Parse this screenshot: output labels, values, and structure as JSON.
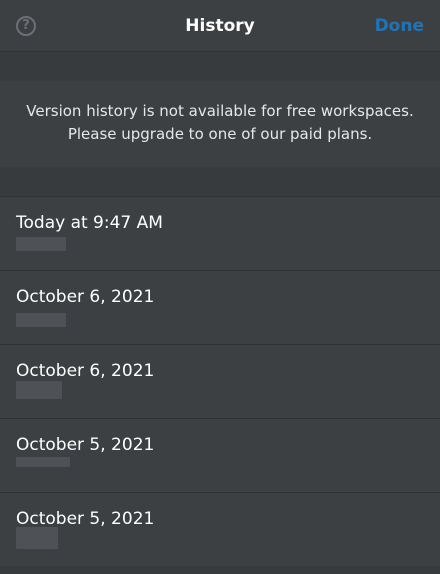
{
  "header": {
    "title": "History",
    "help_icon": "?",
    "done_label": "Done"
  },
  "notice": {
    "line1": "Version history is not available for free workspaces.",
    "line2": "Please upgrade to one of our paid plans."
  },
  "history": {
    "items": [
      {
        "label": "Today at 9:47 AM"
      },
      {
        "label": "October 6, 2021"
      },
      {
        "label": "October 6, 2021"
      },
      {
        "label": "October 5, 2021"
      },
      {
        "label": "October 5, 2021"
      }
    ]
  },
  "colors": {
    "accent": "#1e74b8",
    "background": "#373b3e",
    "panel": "#3c4043",
    "text": "#ffffff"
  }
}
